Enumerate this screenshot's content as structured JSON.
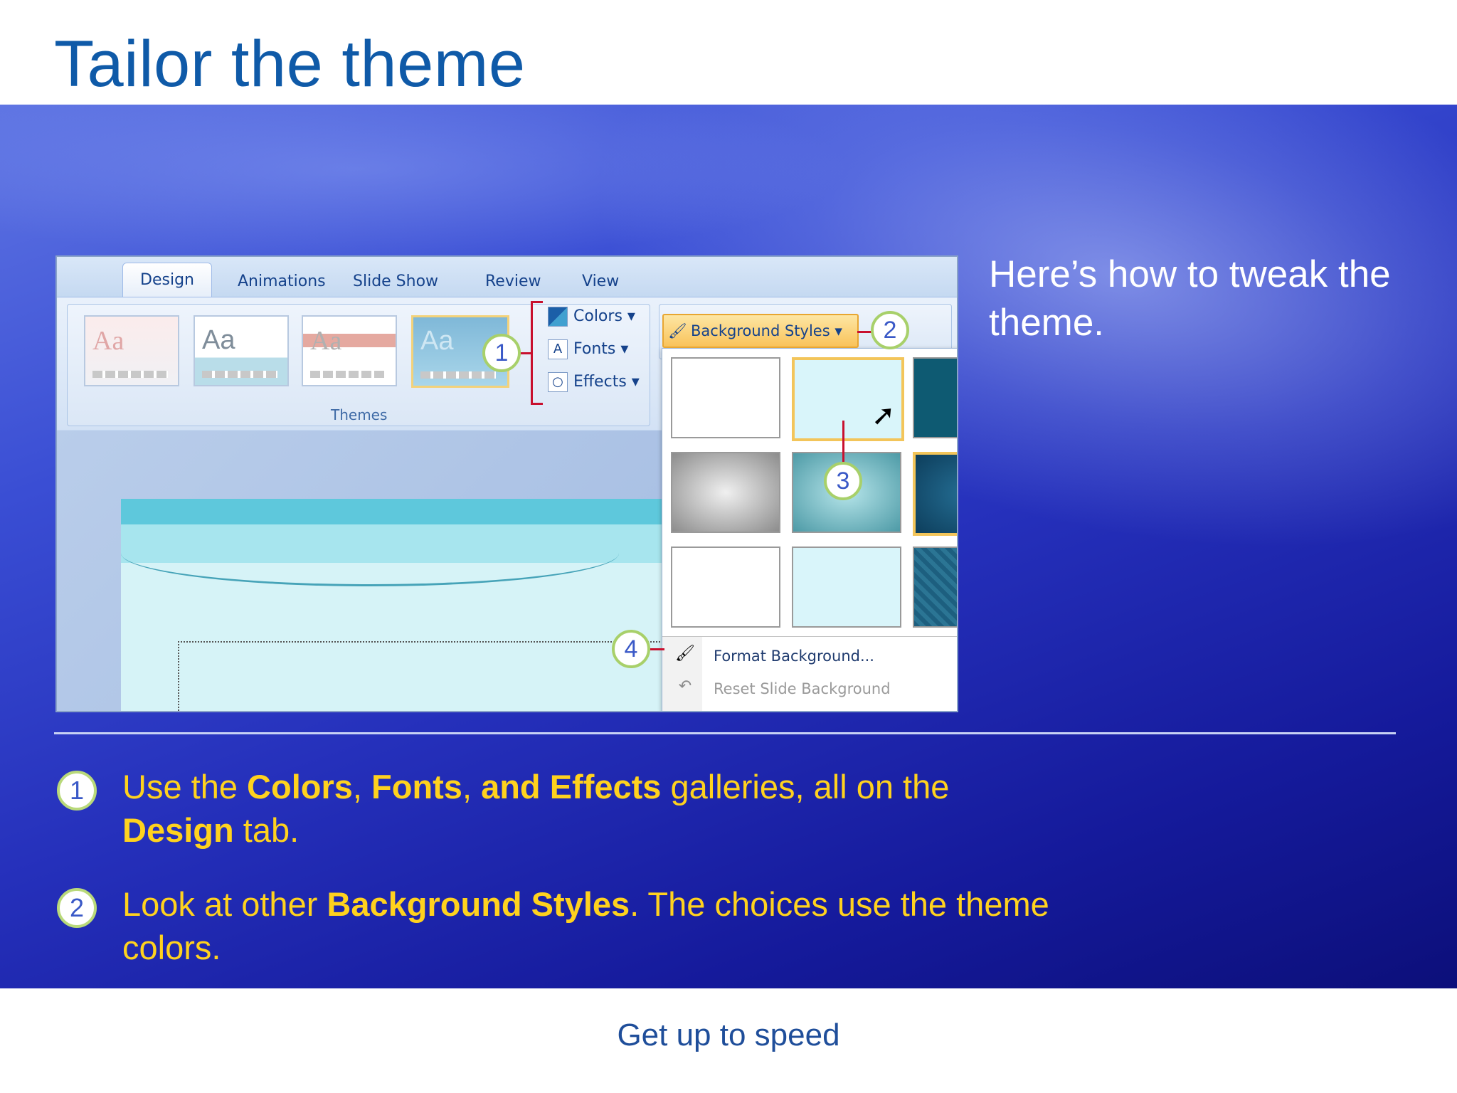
{
  "title": "Tailor the theme",
  "intro": "Here’s how to tweak the theme.",
  "screenshot": {
    "tabs": [
      "Design",
      "Animations",
      "Slide Show",
      "Review",
      "View"
    ],
    "theme_thumb_label": "Aa",
    "themes_group_label": "Themes",
    "theme_buttons": {
      "colors": "Colors",
      "fonts": "Fonts",
      "effects": "Effects"
    },
    "background_styles_label": "Background Styles",
    "menu": {
      "format_background": "Format Background...",
      "reset_slide_background": "Reset Slide Background"
    },
    "callouts": [
      "1",
      "2",
      "3",
      "4"
    ]
  },
  "steps": [
    {
      "number": "1",
      "parts": [
        "Use the ",
        "Colors",
        ", ",
        "Fonts",
        ", ",
        "and Effects",
        " galleries, all on the ",
        "Design",
        " tab."
      ]
    },
    {
      "number": "2",
      "parts": [
        "Look at other ",
        "Background Styles",
        ". The choices use the theme colors."
      ]
    }
  ],
  "footer": "Get up to speed",
  "colors": {
    "title": "#0f5aa8",
    "step_text": "#ffd21e",
    "band": "#2530bb",
    "callout_border": "#a8d06a",
    "callout_line": "#c8102e"
  }
}
